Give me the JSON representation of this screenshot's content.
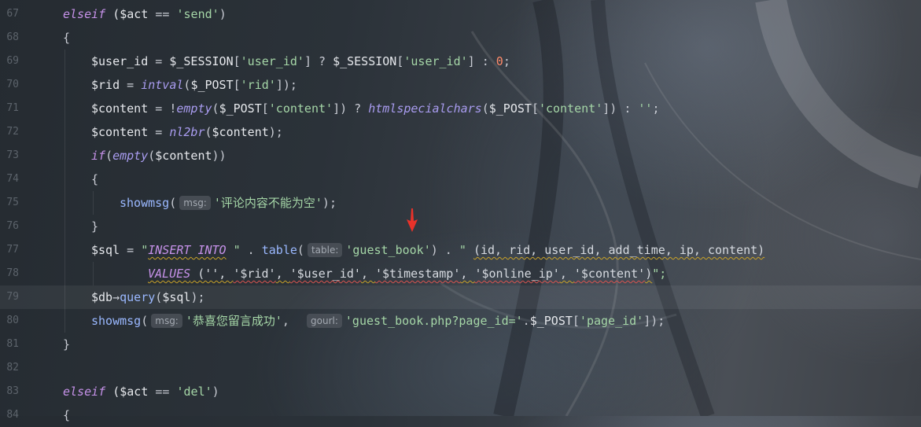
{
  "editor": {
    "current_line": "79",
    "lines": [
      {
        "num": "67",
        "indent": 0,
        "tokens": [
          {
            "t": "elseif",
            "c": "keyword"
          },
          {
            "t": " ($act ",
            "c": "var"
          },
          {
            "t": "==",
            "c": "op"
          },
          {
            "t": " ",
            "c": "plain"
          },
          {
            "t": "'send'",
            "c": "str"
          },
          {
            "t": ")",
            "c": "plain"
          }
        ]
      },
      {
        "num": "68",
        "indent": 0,
        "tokens": [
          {
            "t": "{",
            "c": "plain"
          }
        ]
      },
      {
        "num": "69",
        "indent": 1,
        "tokens": [
          {
            "t": "$user_id",
            "c": "var"
          },
          {
            "t": " = ",
            "c": "op"
          },
          {
            "t": "$_SESSION",
            "c": "var"
          },
          {
            "t": "[",
            "c": "plain"
          },
          {
            "t": "'user_id'",
            "c": "str"
          },
          {
            "t": "] ? ",
            "c": "plain"
          },
          {
            "t": "$_SESSION",
            "c": "var"
          },
          {
            "t": "[",
            "c": "plain"
          },
          {
            "t": "'user_id'",
            "c": "str"
          },
          {
            "t": "] : ",
            "c": "plain"
          },
          {
            "t": "0",
            "c": "num"
          },
          {
            "t": ";",
            "c": "plain"
          }
        ]
      },
      {
        "num": "70",
        "indent": 1,
        "tokens": [
          {
            "t": "$rid",
            "c": "var"
          },
          {
            "t": " = ",
            "c": "op"
          },
          {
            "t": "intval",
            "c": "fnital"
          },
          {
            "t": "(",
            "c": "plain"
          },
          {
            "t": "$_POST",
            "c": "var"
          },
          {
            "t": "[",
            "c": "plain"
          },
          {
            "t": "'rid'",
            "c": "str"
          },
          {
            "t": "]);",
            "c": "plain"
          }
        ]
      },
      {
        "num": "71",
        "indent": 1,
        "tokens": [
          {
            "t": "$content",
            "c": "var"
          },
          {
            "t": " = !",
            "c": "op"
          },
          {
            "t": "empty",
            "c": "fnital"
          },
          {
            "t": "(",
            "c": "plain"
          },
          {
            "t": "$_POST",
            "c": "var"
          },
          {
            "t": "[",
            "c": "plain"
          },
          {
            "t": "'content'",
            "c": "str"
          },
          {
            "t": "]) ? ",
            "c": "plain"
          },
          {
            "t": "htmlspecialchars",
            "c": "fnital"
          },
          {
            "t": "(",
            "c": "plain"
          },
          {
            "t": "$_POST",
            "c": "var"
          },
          {
            "t": "[",
            "c": "plain"
          },
          {
            "t": "'content'",
            "c": "str"
          },
          {
            "t": "]) : ",
            "c": "plain"
          },
          {
            "t": "''",
            "c": "str"
          },
          {
            "t": ";",
            "c": "plain"
          }
        ]
      },
      {
        "num": "72",
        "indent": 1,
        "tokens": [
          {
            "t": "$content",
            "c": "var"
          },
          {
            "t": " = ",
            "c": "op"
          },
          {
            "t": "nl2br",
            "c": "fnital"
          },
          {
            "t": "(",
            "c": "plain"
          },
          {
            "t": "$content",
            "c": "var"
          },
          {
            "t": ");",
            "c": "plain"
          }
        ]
      },
      {
        "num": "73",
        "indent": 1,
        "tokens": [
          {
            "t": "if",
            "c": "keyword"
          },
          {
            "t": "(",
            "c": "plain"
          },
          {
            "t": "empty",
            "c": "fnital"
          },
          {
            "t": "(",
            "c": "plain"
          },
          {
            "t": "$content",
            "c": "var"
          },
          {
            "t": "))",
            "c": "plain"
          }
        ]
      },
      {
        "num": "74",
        "indent": 1,
        "tokens": [
          {
            "t": "{",
            "c": "plain"
          }
        ]
      },
      {
        "num": "75",
        "indent": 2,
        "tokens": [
          {
            "t": "showmsg",
            "c": "fn"
          },
          {
            "t": "(",
            "c": "plain"
          },
          {
            "hint": "msg:"
          },
          {
            "t": "'评论内容不能为空'",
            "c": "str"
          },
          {
            "t": ");",
            "c": "plain"
          }
        ]
      },
      {
        "num": "76",
        "indent": 1,
        "tokens": [
          {
            "t": "}",
            "c": "plain"
          }
        ]
      },
      {
        "num": "77",
        "indent": 1,
        "tokens": [
          {
            "t": "$sql",
            "c": "var"
          },
          {
            "t": " = ",
            "c": "op"
          },
          {
            "t": "\"",
            "c": "str"
          },
          {
            "t": "INSERT INTO",
            "c": "sqlkw",
            "sq": true
          },
          {
            "t": " \"",
            "c": "str"
          },
          {
            "t": " . ",
            "c": "plain"
          },
          {
            "t": "table",
            "c": "fn"
          },
          {
            "t": "(",
            "c": "plain"
          },
          {
            "hint": "table:"
          },
          {
            "t": "'guest_book'",
            "c": "str"
          },
          {
            "t": ") . ",
            "c": "plain"
          },
          {
            "t": "\" ",
            "c": "str"
          },
          {
            "t": "(id, rid, user_id, add_time, ip, content)",
            "c": "sql",
            "sq": true
          }
        ]
      },
      {
        "num": "78",
        "indent": 3,
        "tokens": [
          {
            "t": "VALUES",
            "c": "sqlkw",
            "sq": true
          },
          {
            "t": " ('', ",
            "c": "sql",
            "sq": true
          },
          {
            "t": "'$rid'",
            "c": "sql",
            "sqr": true
          },
          {
            "t": ", ",
            "c": "sql",
            "sq": true
          },
          {
            "t": "'$user_id'",
            "c": "sql",
            "sqr": true
          },
          {
            "t": ", ",
            "c": "sql",
            "sq": true
          },
          {
            "t": "'$timestamp'",
            "c": "sql",
            "sqr": true
          },
          {
            "t": ", ",
            "c": "sql",
            "sq": true
          },
          {
            "t": "'$online_ip'",
            "c": "sql",
            "sqr": true
          },
          {
            "t": ", ",
            "c": "sql",
            "sq": true
          },
          {
            "t": "'$content'",
            "c": "sql",
            "sqr": true
          },
          {
            "t": ")",
            "c": "sql",
            "sq": true
          },
          {
            "t": "\";",
            "c": "str"
          }
        ]
      },
      {
        "num": "79",
        "indent": 1,
        "tokens": [
          {
            "t": "$db",
            "c": "var"
          },
          {
            "t": "→",
            "c": "op"
          },
          {
            "t": "query",
            "c": "fn"
          },
          {
            "t": "(",
            "c": "plain"
          },
          {
            "t": "$sql",
            "c": "var"
          },
          {
            "t": ");",
            "c": "plain"
          }
        ]
      },
      {
        "num": "80",
        "indent": 1,
        "tokens": [
          {
            "t": "showmsg",
            "c": "fn"
          },
          {
            "t": "(",
            "c": "plain"
          },
          {
            "hint": "msg:"
          },
          {
            "t": "'恭喜您留言成功'",
            "c": "str"
          },
          {
            "t": ",  ",
            "c": "plain"
          },
          {
            "hint": "gourl:"
          },
          {
            "t": "'guest_book.php?page_id='",
            "c": "str"
          },
          {
            "t": ".",
            "c": "plain"
          },
          {
            "t": "$_POST",
            "c": "var"
          },
          {
            "t": "[",
            "c": "plain"
          },
          {
            "t": "'page_id'",
            "c": "str"
          },
          {
            "t": "]);",
            "c": "plain"
          }
        ]
      },
      {
        "num": "81",
        "indent": 0,
        "tokens": [
          {
            "t": "}",
            "c": "plain"
          }
        ]
      },
      {
        "num": "82",
        "indent": 0,
        "tokens": []
      },
      {
        "num": "83",
        "indent": 0,
        "tokens": [
          {
            "t": "elseif",
            "c": "keyword"
          },
          {
            "t": " ($act ",
            "c": "var"
          },
          {
            "t": "==",
            "c": "op"
          },
          {
            "t": " ",
            "c": "plain"
          },
          {
            "t": "'del'",
            "c": "str"
          },
          {
            "t": ")",
            "c": "plain"
          }
        ]
      },
      {
        "num": "84",
        "indent": 0,
        "tokens": [
          {
            "t": "{",
            "c": "plain"
          }
        ]
      }
    ]
  },
  "annotation": {
    "icon": "red-arrow-down-icon",
    "color": "#e8322a"
  },
  "colors": {
    "keyword": "#c792ea",
    "string": "#a5d6a7",
    "number": "#ff8b6a",
    "function": "#9ab8ff",
    "warning_squiggle": "#c9a227",
    "error_squiggle": "#d9534f"
  }
}
